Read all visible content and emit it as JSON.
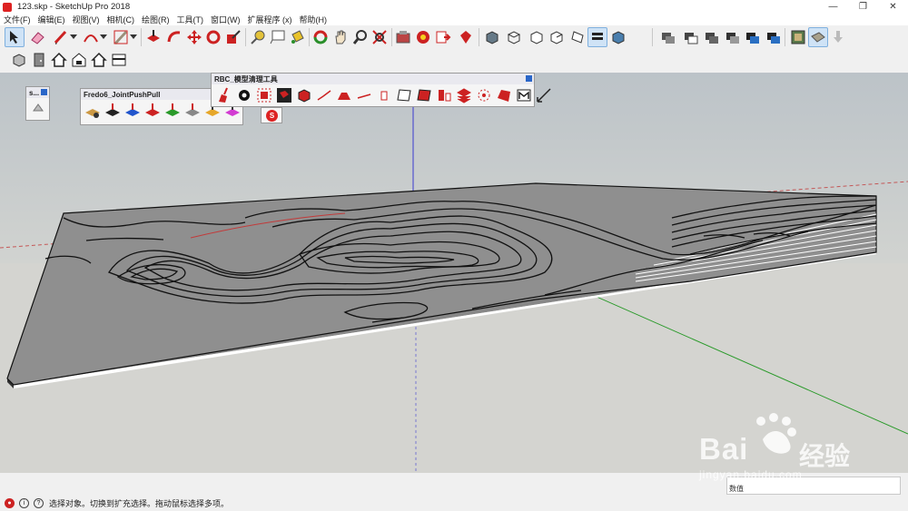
{
  "window": {
    "title": "123.skp - SketchUp Pro 2018",
    "controls": [
      "—",
      "❐",
      "✕"
    ]
  },
  "menu": [
    "文件(F)",
    "编辑(E)",
    "视图(V)",
    "相机(C)",
    "绘图(R)",
    "工具(T)",
    "窗口(W)",
    "扩展程序 (x)",
    "帮助(H)"
  ],
  "toolbar_row1": [
    "select-arrow",
    "eraser",
    "pencil-line",
    "dropdown",
    "arc",
    "dropdown",
    "rectangle",
    "dropdown",
    "push-pull",
    "follow-me",
    "move",
    "rotate",
    "scale",
    "tape-measure",
    "text-label",
    "paint-bucket",
    "orbit",
    "pan",
    "zoom",
    "zoom-extents",
    "3d-warehouse",
    "extension-warehouse",
    "send-to-layout",
    "ruby-extension",
    "iso-view",
    "top-view",
    "front-view",
    "right-view",
    "back-view",
    "left-view",
    "shaded",
    "xray",
    "component-a",
    "component-b",
    "component-c",
    "component-d",
    "component-e",
    "component-f",
    "styles",
    "shadows",
    "download"
  ],
  "toolbar_row2": [
    "solid-tools",
    "door",
    "house",
    "house-outline",
    "house-2",
    "window"
  ],
  "panels": {
    "small": {
      "title": "s..."
    },
    "joint_push_pull": {
      "title": "Fredo6_JointPushPull",
      "icons": [
        "jpp-settings",
        "jpp-joint",
        "jpp-vector",
        "jpp-normal",
        "jpp-extrude",
        "jpp-follow",
        "jpp-orient",
        "jpp-undo"
      ]
    },
    "rbc": {
      "title": "RBC_模型清理工具",
      "icons": [
        "broom",
        "gear",
        "cleanup-group",
        "cube-red-a",
        "cube-red-b",
        "line-tool",
        "plane-tool",
        "line-2",
        "trash",
        "shape-outline",
        "shape-red",
        "cylinder",
        "stack",
        "circle-dots",
        "red-shape",
        "m-tool",
        "measure"
      ]
    }
  },
  "status": {
    "text": "选择对象。切换到扩充选择。拖动鼠标选择多项。",
    "measure_label": "数值"
  },
  "watermark": {
    "brand": "Bai",
    "cn": "经验",
    "url": "jingyan.baidu.com"
  }
}
